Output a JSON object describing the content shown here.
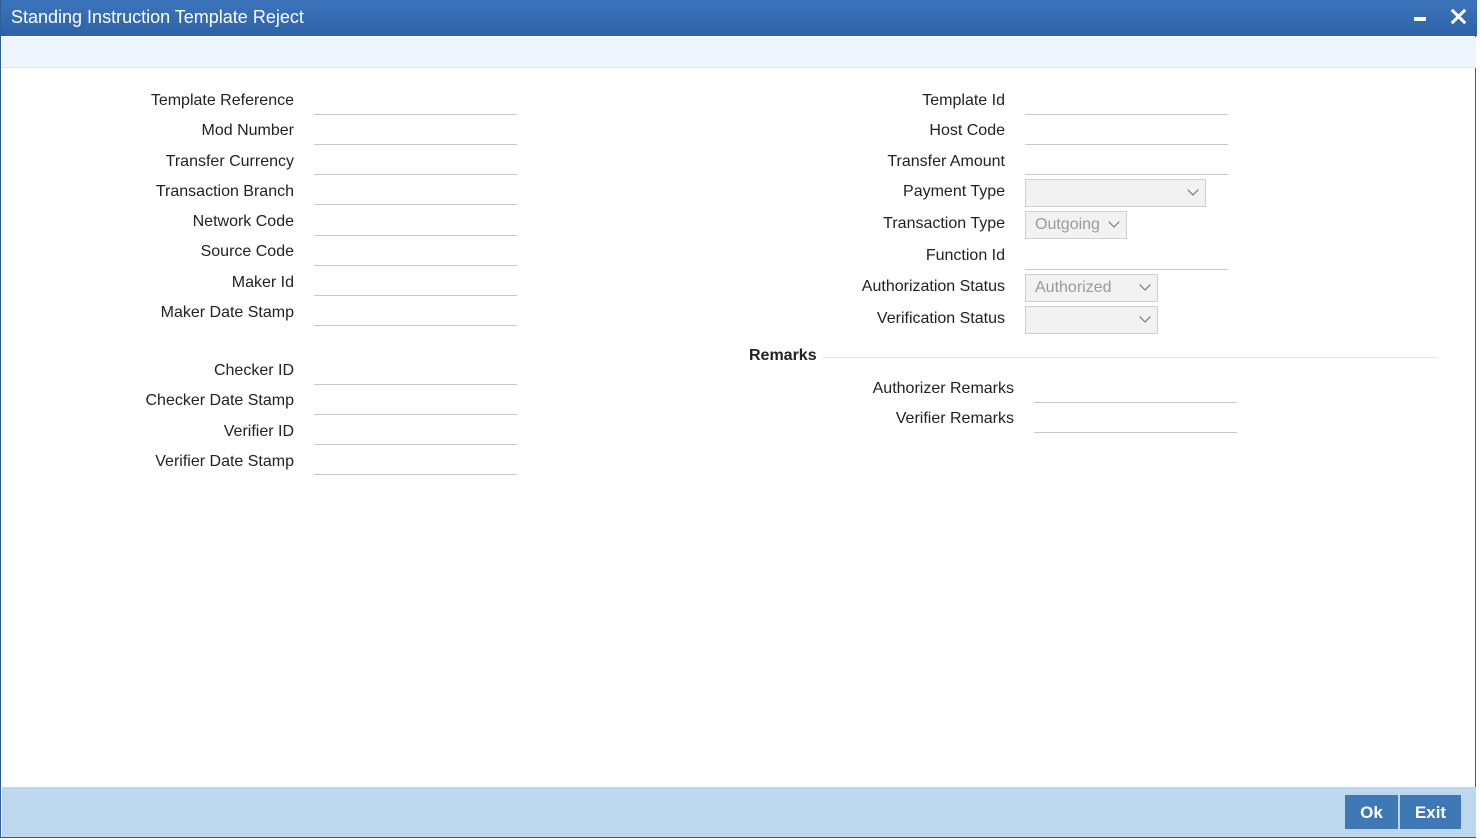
{
  "window": {
    "title": "Standing Instruction Template Reject"
  },
  "form": {
    "left": [
      {
        "label": "Template Reference",
        "value": ""
      },
      {
        "label": "Mod Number",
        "value": ""
      },
      {
        "label": "Transfer Currency",
        "value": ""
      },
      {
        "label": "Transaction Branch",
        "value": ""
      },
      {
        "label": "Network Code",
        "value": ""
      },
      {
        "label": "Source Code",
        "value": ""
      },
      {
        "label": "Maker Id",
        "value": ""
      },
      {
        "label": "Maker Date Stamp",
        "value": ""
      },
      {
        "label": "Checker ID",
        "value": ""
      },
      {
        "label": "Checker Date Stamp",
        "value": ""
      },
      {
        "label": "Verifier ID",
        "value": ""
      },
      {
        "label": "Verifier Date Stamp",
        "value": ""
      }
    ],
    "right": {
      "template_id": {
        "label": "Template Id",
        "value": ""
      },
      "host_code": {
        "label": "Host Code",
        "value": ""
      },
      "transfer_amount": {
        "label": "Transfer Amount",
        "value": ""
      },
      "payment_type": {
        "label": "Payment Type",
        "value": ""
      },
      "transaction_type": {
        "label": "Transaction Type",
        "value": "Outgoing"
      },
      "function_id": {
        "label": "Function Id",
        "value": ""
      },
      "authorization_status": {
        "label": "Authorization Status",
        "value": "Authorized"
      },
      "verification_status": {
        "label": "Verification Status",
        "value": ""
      }
    },
    "remarks": {
      "title": "Remarks",
      "authorizer": {
        "label": "Authorizer Remarks",
        "value": ""
      },
      "verifier": {
        "label": "Verifier Remarks",
        "value": ""
      }
    }
  },
  "footer": {
    "ok_label": "Ok",
    "exit_label": "Exit"
  },
  "colors": {
    "titlebar": "#2e62a8",
    "footer": "#bdd7ee",
    "button": "#3e78b5"
  }
}
